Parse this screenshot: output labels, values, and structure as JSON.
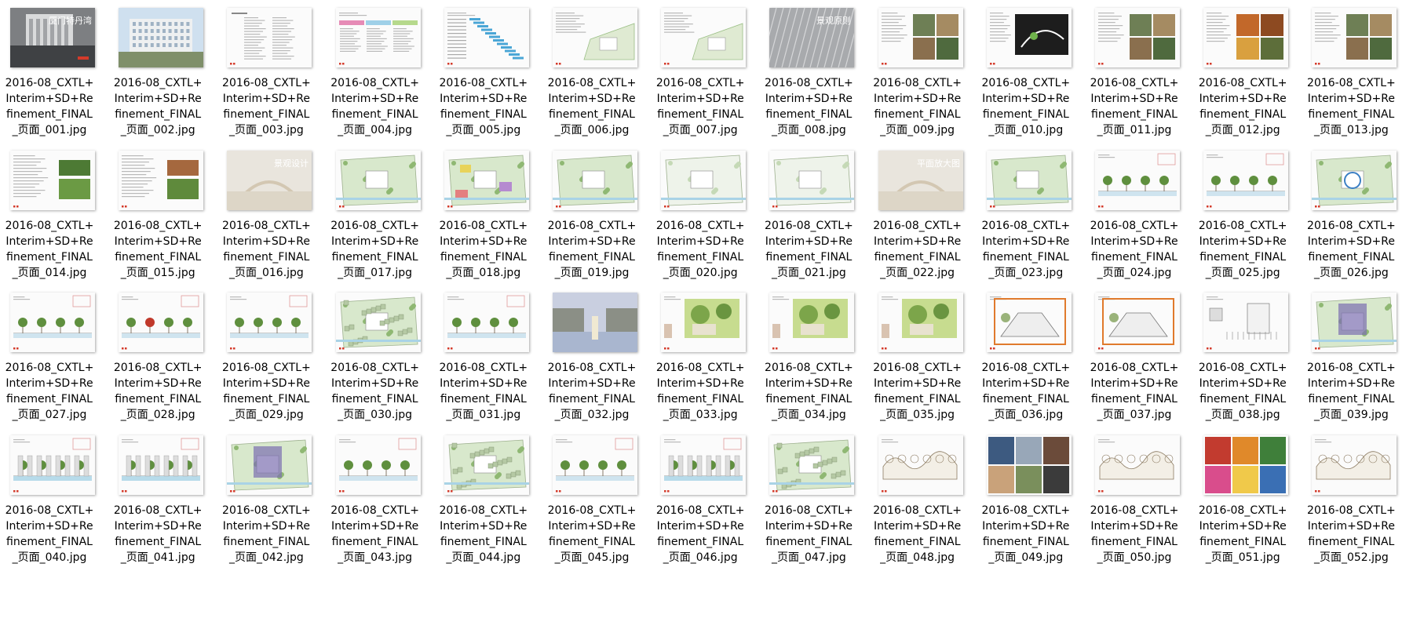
{
  "files": [
    {
      "name": "2016-08_CXTL+\nInterim+SD+Re\nfinement_FINAL\n_页面_001.jpg",
      "thumb": "photo-gray",
      "overlay": "厦门特丹湾",
      "icon": "image-file-icon"
    },
    {
      "name": "2016-08_CXTL+\nInterim+SD+Re\nfinement_FINAL\n_页面_002.jpg",
      "thumb": "photo-building",
      "icon": "image-file-icon"
    },
    {
      "name": "2016-08_CXTL+\nInterim+SD+Re\nfinement_FINAL\n_页面_003.jpg",
      "thumb": "text",
      "icon": "image-file-icon"
    },
    {
      "name": "2016-08_CXTL+\nInterim+SD+Re\nfinement_FINAL\n_页面_004.jpg",
      "thumb": "table-color",
      "icon": "image-file-icon"
    },
    {
      "name": "2016-08_CXTL+\nInterim+SD+Re\nfinement_FINAL\n_页面_005.jpg",
      "thumb": "gantt",
      "icon": "image-file-icon"
    },
    {
      "name": "2016-08_CXTL+\nInterim+SD+Re\nfinement_FINAL\n_页面_006.jpg",
      "thumb": "text-plan",
      "icon": "image-file-icon"
    },
    {
      "name": "2016-08_CXTL+\nInterim+SD+Re\nfinement_FINAL\n_页面_007.jpg",
      "thumb": "text-plan",
      "icon": "image-file-icon"
    },
    {
      "name": "2016-08_CXTL+\nInterim+SD+Re\nfinement_FINAL\n_页面_008.jpg",
      "thumb": "photo-silver",
      "overlay": "景观原则",
      "icon": "image-file-icon"
    },
    {
      "name": "2016-08_CXTL+\nInterim+SD+Re\nfinement_FINAL\n_页面_009.jpg",
      "thumb": "text-photos",
      "icon": "image-file-icon"
    },
    {
      "name": "2016-08_CXTL+\nInterim+SD+Re\nfinement_FINAL\n_页面_010.jpg",
      "thumb": "text-dark",
      "icon": "image-file-icon"
    },
    {
      "name": "2016-08_CXTL+\nInterim+SD+Re\nfinement_FINAL\n_页面_011.jpg",
      "thumb": "text-photos",
      "icon": "image-file-icon"
    },
    {
      "name": "2016-08_CXTL+\nInterim+SD+Re\nfinement_FINAL\n_页面_012.jpg",
      "thumb": "text-autumn",
      "icon": "image-file-icon"
    },
    {
      "name": "2016-08_CXTL+\nInterim+SD+Re\nfinement_FINAL\n_页面_013.jpg",
      "thumb": "text-photos",
      "icon": "image-file-icon"
    },
    {
      "name": "2016-08_CXTL+\nInterim+SD+Re\nfinement_FINAL\n_页面_014.jpg",
      "thumb": "text-green",
      "icon": "image-file-icon"
    },
    {
      "name": "2016-08_CXTL+\nInterim+SD+Re\nfinement_FINAL\n_页面_015.jpg",
      "thumb": "text-brown",
      "icon": "image-file-icon"
    },
    {
      "name": "2016-08_CXTL+\nInterim+SD+Re\nfinement_FINAL\n_页面_016.jpg",
      "thumb": "photo-faded",
      "overlay": "景观设计",
      "icon": "image-file-icon"
    },
    {
      "name": "2016-08_CXTL+\nInterim+SD+Re\nfinement_FINAL\n_页面_017.jpg",
      "thumb": "plan",
      "icon": "image-file-icon"
    },
    {
      "name": "2016-08_CXTL+\nInterim+SD+Re\nfinement_FINAL\n_页面_018.jpg",
      "thumb": "plan-color",
      "icon": "image-file-icon"
    },
    {
      "name": "2016-08_CXTL+\nInterim+SD+Re\nfinement_FINAL\n_页面_019.jpg",
      "thumb": "plan",
      "icon": "image-file-icon"
    },
    {
      "name": "2016-08_CXTL+\nInterim+SD+Re\nfinement_FINAL\n_页面_020.jpg",
      "thumb": "plan-faded",
      "icon": "image-file-icon"
    },
    {
      "name": "2016-08_CXTL+\nInterim+SD+Re\nfinement_FINAL\n_页面_021.jpg",
      "thumb": "plan-faded",
      "icon": "image-file-icon"
    },
    {
      "name": "2016-08_CXTL+\nInterim+SD+Re\nfinement_FINAL\n_页面_022.jpg",
      "thumb": "photo-faded",
      "overlay": "平面放大图",
      "icon": "image-file-icon"
    },
    {
      "name": "2016-08_CXTL+\nInterim+SD+Re\nfinement_FINAL\n_页面_023.jpg",
      "thumb": "plan",
      "icon": "image-file-icon"
    },
    {
      "name": "2016-08_CXTL+\nInterim+SD+Re\nfinement_FINAL\n_页面_024.jpg",
      "thumb": "section",
      "icon": "image-file-icon"
    },
    {
      "name": "2016-08_CXTL+\nInterim+SD+Re\nfinement_FINAL\n_页面_025.jpg",
      "thumb": "section",
      "icon": "image-file-icon"
    },
    {
      "name": "2016-08_CXTL+\nInterim+SD+Re\nfinement_FINAL\n_页面_026.jpg",
      "thumb": "plan-round",
      "icon": "image-file-icon"
    },
    {
      "name": "2016-08_CXTL+\nInterim+SD+Re\nfinement_FINAL\n_页面_027.jpg",
      "thumb": "section",
      "icon": "image-file-icon"
    },
    {
      "name": "2016-08_CXTL+\nInterim+SD+Re\nfinement_FINAL\n_页面_028.jpg",
      "thumb": "section-red",
      "icon": "image-file-icon"
    },
    {
      "name": "2016-08_CXTL+\nInterim+SD+Re\nfinement_FINAL\n_页面_029.jpg",
      "thumb": "section",
      "icon": "image-file-icon"
    },
    {
      "name": "2016-08_CXTL+\nInterim+SD+Re\nfinement_FINAL\n_页面_030.jpg",
      "thumb": "plan-dense",
      "icon": "image-file-icon"
    },
    {
      "name": "2016-08_CXTL+\nInterim+SD+Re\nfinement_FINAL\n_页面_031.jpg",
      "thumb": "section",
      "icon": "image-file-icon"
    },
    {
      "name": "2016-08_CXTL+\nInterim+SD+Re\nfinement_FINAL\n_页面_032.jpg",
      "thumb": "photo-render",
      "icon": "image-file-icon"
    },
    {
      "name": "2016-08_CXTL+\nInterim+SD+Re\nfinement_FINAL\n_页面_033.jpg",
      "thumb": "sketch",
      "icon": "image-file-icon"
    },
    {
      "name": "2016-08_CXTL+\nInterim+SD+Re\nfinement_FINAL\n_页面_034.jpg",
      "thumb": "sketch",
      "icon": "image-file-icon"
    },
    {
      "name": "2016-08_CXTL+\nInterim+SD+Re\nfinement_FINAL\n_页面_035.jpg",
      "thumb": "sketch",
      "icon": "image-file-icon"
    },
    {
      "name": "2016-08_CXTL+\nInterim+SD+Re\nfinement_FINAL\n_页面_036.jpg",
      "thumb": "sketch-orange",
      "icon": "image-file-icon"
    },
    {
      "name": "2016-08_CXTL+\nInterim+SD+Re\nfinement_FINAL\n_页面_037.jpg",
      "thumb": "sketch-orange",
      "icon": "image-file-icon"
    },
    {
      "name": "2016-08_CXTL+\nInterim+SD+Re\nfinement_FINAL\n_页面_038.jpg",
      "thumb": "elevation",
      "icon": "image-file-icon"
    },
    {
      "name": "2016-08_CXTL+\nInterim+SD+Re\nfinement_FINAL\n_页面_039.jpg",
      "thumb": "plan-purple",
      "icon": "image-file-icon"
    },
    {
      "name": "2016-08_CXTL+\nInterim+SD+Re\nfinement_FINAL\n_页面_040.jpg",
      "thumb": "section-blue",
      "icon": "image-file-icon"
    },
    {
      "name": "2016-08_CXTL+\nInterim+SD+Re\nfinement_FINAL\n_页面_041.jpg",
      "thumb": "section-blue",
      "icon": "image-file-icon"
    },
    {
      "name": "2016-08_CXTL+\nInterim+SD+Re\nfinement_FINAL\n_页面_042.jpg",
      "thumb": "plan-purple",
      "icon": "image-file-icon"
    },
    {
      "name": "2016-08_CXTL+\nInterim+SD+Re\nfinement_FINAL\n_页面_043.jpg",
      "thumb": "section",
      "icon": "image-file-icon"
    },
    {
      "name": "2016-08_CXTL+\nInterim+SD+Re\nfinement_FINAL\n_页面_044.jpg",
      "thumb": "plan-dense",
      "icon": "image-file-icon"
    },
    {
      "name": "2016-08_CXTL+\nInterim+SD+Re\nfinement_FINAL\n_页面_045.jpg",
      "thumb": "section",
      "icon": "image-file-icon"
    },
    {
      "name": "2016-08_CXTL+\nInterim+SD+Re\nfinement_FINAL\n_页面_046.jpg",
      "thumb": "section-blue",
      "icon": "image-file-icon"
    },
    {
      "name": "2016-08_CXTL+\nInterim+SD+Re\nfinement_FINAL\n_页面_047.jpg",
      "thumb": "plan-dense",
      "icon": "image-file-icon"
    },
    {
      "name": "2016-08_CXTL+\nInterim+SD+Re\nfinement_FINAL\n_页面_048.jpg",
      "thumb": "sketch-line",
      "icon": "image-file-icon"
    },
    {
      "name": "2016-08_CXTL+\nInterim+SD+Re\nfinement_FINAL\n_页面_049.jpg",
      "thumb": "photo-grid",
      "icon": "image-file-icon"
    },
    {
      "name": "2016-08_CXTL+\nInterim+SD+Re\nfinement_FINAL\n_页面_050.jpg",
      "thumb": "sketch-line",
      "icon": "image-file-icon"
    },
    {
      "name": "2016-08_CXTL+\nInterim+SD+Re\nfinement_FINAL\n_页面_051.jpg",
      "thumb": "photo-colorful",
      "icon": "image-file-icon"
    },
    {
      "name": "2016-08_CXTL+\nInterim+SD+Re\nfinement_FINAL\n_页面_052.jpg",
      "thumb": "sketch-line",
      "icon": "image-file-icon"
    }
  ],
  "colors": {
    "background": "#ffffff",
    "text": "#000000",
    "accent_red": "#d43a2a",
    "plan_green": "#8fb873",
    "water_blue": "#a9d3e6",
    "orange": "#e07a2c",
    "purple": "#7c6fb0"
  }
}
